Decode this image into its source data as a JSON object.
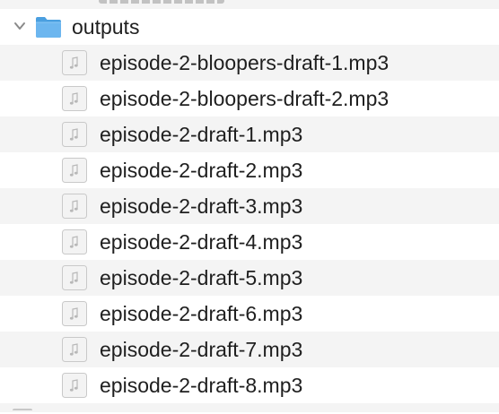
{
  "folder": {
    "name": "outputs",
    "icon": "folder-icon",
    "expanded": true,
    "color": "#5aa9e6"
  },
  "files": [
    {
      "name": "episode-2-bloopers-draft-1.mp3",
      "icon": "audio-file-icon"
    },
    {
      "name": "episode-2-bloopers-draft-2.mp3",
      "icon": "audio-file-icon"
    },
    {
      "name": "episode-2-draft-1.mp3",
      "icon": "audio-file-icon"
    },
    {
      "name": "episode-2-draft-2.mp3",
      "icon": "audio-file-icon"
    },
    {
      "name": "episode-2-draft-3.mp3",
      "icon": "audio-file-icon"
    },
    {
      "name": "episode-2-draft-4.mp3",
      "icon": "audio-file-icon"
    },
    {
      "name": "episode-2-draft-5.mp3",
      "icon": "audio-file-icon"
    },
    {
      "name": "episode-2-draft-6.mp3",
      "icon": "audio-file-icon"
    },
    {
      "name": "episode-2-draft-7.mp3",
      "icon": "audio-file-icon"
    },
    {
      "name": "episode-2-draft-8.mp3",
      "icon": "audio-file-icon"
    }
  ]
}
